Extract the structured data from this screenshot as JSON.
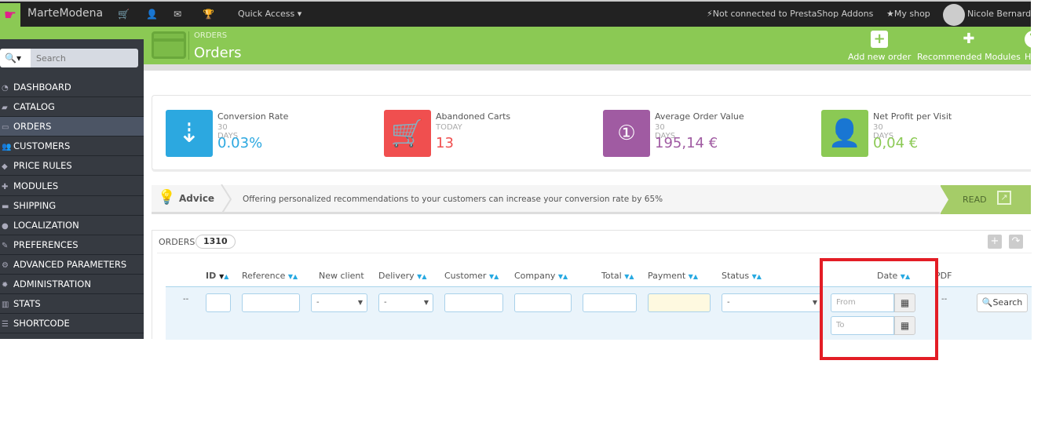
{
  "topbar": {
    "shop_name": "MarteModena",
    "quick_access": "Quick Access",
    "addons": "Not connected to PrestaShop Addons",
    "my_shop": "My shop",
    "user": "Nicole Bernardini"
  },
  "sidebar": {
    "search_placeholder": "Search",
    "items": [
      {
        "label": "DASHBOARD",
        "icon": "dashboard-icon"
      },
      {
        "label": "CATALOG",
        "icon": "book-icon"
      },
      {
        "label": "ORDERS",
        "icon": "credit-card-icon",
        "active": true
      },
      {
        "label": "CUSTOMERS",
        "icon": "users-icon"
      },
      {
        "label": "PRICE RULES",
        "icon": "tag-icon"
      },
      {
        "label": "MODULES",
        "icon": "puzzle-icon"
      },
      {
        "label": "SHIPPING",
        "icon": "truck-icon"
      },
      {
        "label": "LOCALIZATION",
        "icon": "globe-icon"
      },
      {
        "label": "PREFERENCES",
        "icon": "wrench-icon"
      },
      {
        "label": "ADVANCED PARAMETERS",
        "icon": "cogs-icon"
      },
      {
        "label": "ADMINISTRATION",
        "icon": "gear-icon"
      },
      {
        "label": "STATS",
        "icon": "bar-chart-icon"
      },
      {
        "label": "SHORTCODE",
        "icon": "list-icon"
      }
    ]
  },
  "header": {
    "breadcrumb": "ORDERS",
    "title": "Orders",
    "add_new_order": "Add new order",
    "recommended_modules": "Recommended Modules",
    "help": "Help"
  },
  "kpis": [
    {
      "title": "Conversion Rate",
      "period": "30 DAYS",
      "value": "0.03%",
      "color": "#2ca8e0"
    },
    {
      "title": "Abandoned Carts",
      "period": "TODAY",
      "value": "13",
      "color": "#f04f4f"
    },
    {
      "title": "Average Order Value",
      "period": "30 DAYS",
      "value": "195,14 €",
      "color": "#a05ba2"
    },
    {
      "title": "Net Profit per Visit",
      "period": "30 DAYS",
      "value": "0,04 €",
      "color": "#8bc954"
    }
  ],
  "advice": {
    "title": "Advice",
    "text": "Offering personalized recommendations to your customers can increase your conversion rate by 65%",
    "read": "READ"
  },
  "orders": {
    "title": "ORDERS",
    "count": "1310",
    "columns": [
      "ID",
      "Reference",
      "New client",
      "Delivery",
      "Customer",
      "Company",
      "Total",
      "Payment",
      "Status",
      "Date",
      "PDF"
    ],
    "filters": {
      "row_prefix": "--",
      "new_client": "-",
      "delivery": "-",
      "status": "-",
      "date_from_placeholder": "From",
      "date_to_placeholder": "To",
      "pdf": "--",
      "search": "Search"
    }
  },
  "colors": {
    "brand_green": "#8bc954",
    "topbar": "#222222",
    "sidebar": "#363a41",
    "highlight": "#e31d25"
  }
}
